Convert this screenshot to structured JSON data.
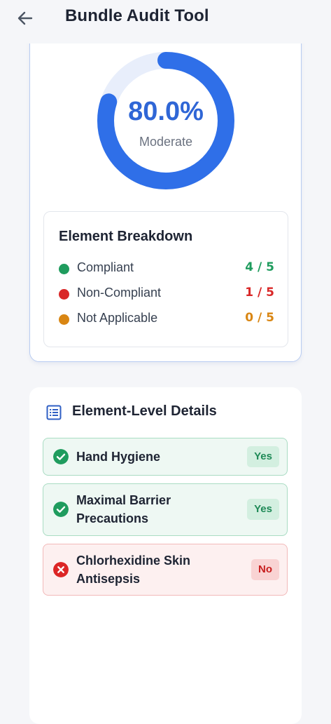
{
  "header": {
    "title": "Bundle Audit Tool",
    "back_icon": "arrow-left-icon"
  },
  "score": {
    "percent_text": "80.0%",
    "percent_value": 80.0,
    "rating": "Moderate",
    "gauge_color": "#2f6fe8",
    "track_color": "#e8eefb"
  },
  "breakdown": {
    "title": "Element Breakdown",
    "rows": [
      {
        "label": "Compliant",
        "value": "4 / 5",
        "color": "#1f9c5e"
      },
      {
        "label": "Non-Compliant",
        "value": "1 / 5",
        "color": "#d92727"
      },
      {
        "label": "Not Applicable",
        "value": "0 / 5",
        "color": "#d98613"
      }
    ]
  },
  "details": {
    "title": "Element-Level Details",
    "icon": "list-icon",
    "items": [
      {
        "label": "Hand Hygiene",
        "status": "Yes",
        "icon": "check-circle-icon"
      },
      {
        "label": "Maximal Barrier Precautions",
        "status": "Yes",
        "icon": "check-circle-icon"
      },
      {
        "label": "Chlorhexidine Skin Antisepsis",
        "status": "No",
        "icon": "x-circle-icon"
      }
    ]
  }
}
